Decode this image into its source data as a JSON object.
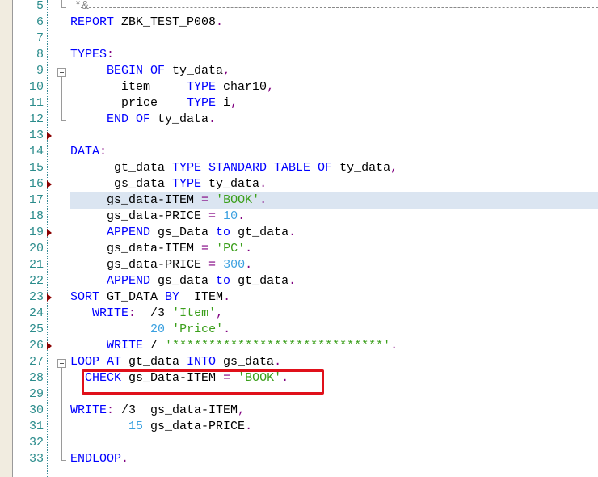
{
  "editor": {
    "highlighted_line": 17,
    "boxed_line": 28,
    "lines": [
      {
        "n": "5",
        "tokens": [
          {
            "t": "*&",
            "c": "cm"
          }
        ],
        "marker": false
      },
      {
        "n": "6",
        "tokens": [
          {
            "t": "REPORT",
            "c": "kw"
          },
          {
            "t": " ZBK_TEST_P008",
            "c": ""
          },
          {
            "t": ".",
            "c": "pn"
          }
        ],
        "marker": false
      },
      {
        "n": "7",
        "tokens": [],
        "marker": false
      },
      {
        "n": "8",
        "tokens": [
          {
            "t": "TYPES",
            "c": "kw"
          },
          {
            "t": ":",
            "c": "pn"
          }
        ],
        "marker": false
      },
      {
        "n": "9",
        "tokens": [
          {
            "t": "     ",
            "c": ""
          },
          {
            "t": "BEGIN OF",
            "c": "kw"
          },
          {
            "t": " ty_data",
            "c": ""
          },
          {
            "t": ",",
            "c": "pn"
          }
        ],
        "marker": false
      },
      {
        "n": "10",
        "tokens": [
          {
            "t": "       item     ",
            "c": ""
          },
          {
            "t": "TYPE",
            "c": "kw"
          },
          {
            "t": " char10",
            "c": ""
          },
          {
            "t": ",",
            "c": "pn"
          }
        ],
        "marker": false
      },
      {
        "n": "11",
        "tokens": [
          {
            "t": "       price    ",
            "c": ""
          },
          {
            "t": "TYPE",
            "c": "kw"
          },
          {
            "t": " i",
            "c": ""
          },
          {
            "t": ",",
            "c": "pn"
          }
        ],
        "marker": false
      },
      {
        "n": "12",
        "tokens": [
          {
            "t": "     ",
            "c": ""
          },
          {
            "t": "END OF",
            "c": "kw"
          },
          {
            "t": " ty_data",
            "c": ""
          },
          {
            "t": ".",
            "c": "pn"
          }
        ],
        "marker": false
      },
      {
        "n": "13",
        "tokens": [],
        "marker": true
      },
      {
        "n": "14",
        "tokens": [
          {
            "t": "DATA",
            "c": "kw"
          },
          {
            "t": ":",
            "c": "pn"
          }
        ],
        "marker": false
      },
      {
        "n": "15",
        "tokens": [
          {
            "t": "      gt_data ",
            "c": ""
          },
          {
            "t": "TYPE STANDARD TABLE OF",
            "c": "kw"
          },
          {
            "t": " ty_data",
            "c": ""
          },
          {
            "t": ",",
            "c": "pn"
          }
        ],
        "marker": false
      },
      {
        "n": "16",
        "tokens": [
          {
            "t": "      gs_data ",
            "c": ""
          },
          {
            "t": "TYPE",
            "c": "kw"
          },
          {
            "t": " ty_data",
            "c": ""
          },
          {
            "t": ".",
            "c": "pn"
          }
        ],
        "marker": true
      },
      {
        "n": "17",
        "tokens": [
          {
            "t": "     gs_data-ITEM ",
            "c": ""
          },
          {
            "t": "=",
            "c": "pn"
          },
          {
            "t": " ",
            "c": ""
          },
          {
            "t": "'BOOK'",
            "c": "str"
          },
          {
            "t": ".",
            "c": "pn"
          }
        ],
        "marker": false
      },
      {
        "n": "18",
        "tokens": [
          {
            "t": "     gs_data-PRICE ",
            "c": ""
          },
          {
            "t": "=",
            "c": "pn"
          },
          {
            "t": " ",
            "c": ""
          },
          {
            "t": "10",
            "c": "num"
          },
          {
            "t": ".",
            "c": "pn"
          }
        ],
        "marker": false
      },
      {
        "n": "19",
        "tokens": [
          {
            "t": "     ",
            "c": ""
          },
          {
            "t": "APPEND",
            "c": "kw"
          },
          {
            "t": " gs_Data ",
            "c": ""
          },
          {
            "t": "to",
            "c": "kw"
          },
          {
            "t": " gt_data",
            "c": ""
          },
          {
            "t": ".",
            "c": "pn"
          }
        ],
        "marker": true
      },
      {
        "n": "20",
        "tokens": [
          {
            "t": "     gs_data-ITEM ",
            "c": ""
          },
          {
            "t": "=",
            "c": "pn"
          },
          {
            "t": " ",
            "c": ""
          },
          {
            "t": "'PC'",
            "c": "str"
          },
          {
            "t": ".",
            "c": "pn"
          }
        ],
        "marker": false
      },
      {
        "n": "21",
        "tokens": [
          {
            "t": "     gs_data-PRICE ",
            "c": ""
          },
          {
            "t": "=",
            "c": "pn"
          },
          {
            "t": " ",
            "c": ""
          },
          {
            "t": "300",
            "c": "num"
          },
          {
            "t": ".",
            "c": "pn"
          }
        ],
        "marker": false
      },
      {
        "n": "22",
        "tokens": [
          {
            "t": "     ",
            "c": ""
          },
          {
            "t": "APPEND",
            "c": "kw"
          },
          {
            "t": " gs_data ",
            "c": ""
          },
          {
            "t": "to",
            "c": "kw"
          },
          {
            "t": " gt_data",
            "c": ""
          },
          {
            "t": ".",
            "c": "pn"
          }
        ],
        "marker": false
      },
      {
        "n": "23",
        "tokens": [
          {
            "t": "SORT",
            "c": "kw"
          },
          {
            "t": " GT_DATA ",
            "c": ""
          },
          {
            "t": "BY",
            "c": "kw"
          },
          {
            "t": "  ITEM",
            "c": ""
          },
          {
            "t": ".",
            "c": "pn"
          }
        ],
        "marker": true
      },
      {
        "n": "24",
        "tokens": [
          {
            "t": "   ",
            "c": ""
          },
          {
            "t": "WRITE",
            "c": "kw"
          },
          {
            "t": ":",
            "c": "pn"
          },
          {
            "t": "  /3 ",
            "c": ""
          },
          {
            "t": "'Item'",
            "c": "str"
          },
          {
            "t": ",",
            "c": "pn"
          }
        ],
        "marker": false
      },
      {
        "n": "25",
        "tokens": [
          {
            "t": "           ",
            "c": ""
          },
          {
            "t": "20",
            "c": "num"
          },
          {
            "t": " ",
            "c": ""
          },
          {
            "t": "'Price'",
            "c": "str"
          },
          {
            "t": ".",
            "c": "pn"
          }
        ],
        "marker": false
      },
      {
        "n": "26",
        "tokens": [
          {
            "t": "     ",
            "c": ""
          },
          {
            "t": "WRITE",
            "c": "kw"
          },
          {
            "t": " / ",
            "c": ""
          },
          {
            "t": "'*****************************'",
            "c": "str"
          },
          {
            "t": ".",
            "c": "pn"
          }
        ],
        "marker": true
      },
      {
        "n": "27",
        "tokens": [
          {
            "t": "LOOP AT",
            "c": "kw"
          },
          {
            "t": " gt_data ",
            "c": ""
          },
          {
            "t": "INTO",
            "c": "kw"
          },
          {
            "t": " gs_data",
            "c": ""
          },
          {
            "t": ".",
            "c": "pn"
          }
        ],
        "marker": false
      },
      {
        "n": "28",
        "tokens": [
          {
            "t": "  ",
            "c": ""
          },
          {
            "t": "CHECK",
            "c": "kw"
          },
          {
            "t": " gs_Data-ITEM ",
            "c": ""
          },
          {
            "t": "=",
            "c": "pn"
          },
          {
            "t": " ",
            "c": ""
          },
          {
            "t": "'BOOK'",
            "c": "str"
          },
          {
            "t": ".",
            "c": "pn"
          }
        ],
        "marker": false
      },
      {
        "n": "29",
        "tokens": [],
        "marker": false
      },
      {
        "n": "30",
        "tokens": [
          {
            "t": "WRITE",
            "c": "kw"
          },
          {
            "t": ":",
            "c": "pn"
          },
          {
            "t": " /3  gs_data-ITEM",
            "c": ""
          },
          {
            "t": ",",
            "c": "pn"
          }
        ],
        "marker": false
      },
      {
        "n": "31",
        "tokens": [
          {
            "t": "        ",
            "c": ""
          },
          {
            "t": "15",
            "c": "num"
          },
          {
            "t": " gs_data-PRICE",
            "c": ""
          },
          {
            "t": ".",
            "c": "pn"
          }
        ],
        "marker": false
      },
      {
        "n": "32",
        "tokens": [],
        "marker": false
      },
      {
        "n": "33",
        "tokens": [
          {
            "t": "ENDLOOP",
            "c": "kw"
          },
          {
            "t": ".",
            "c": "pn"
          }
        ],
        "marker": false
      }
    ]
  }
}
